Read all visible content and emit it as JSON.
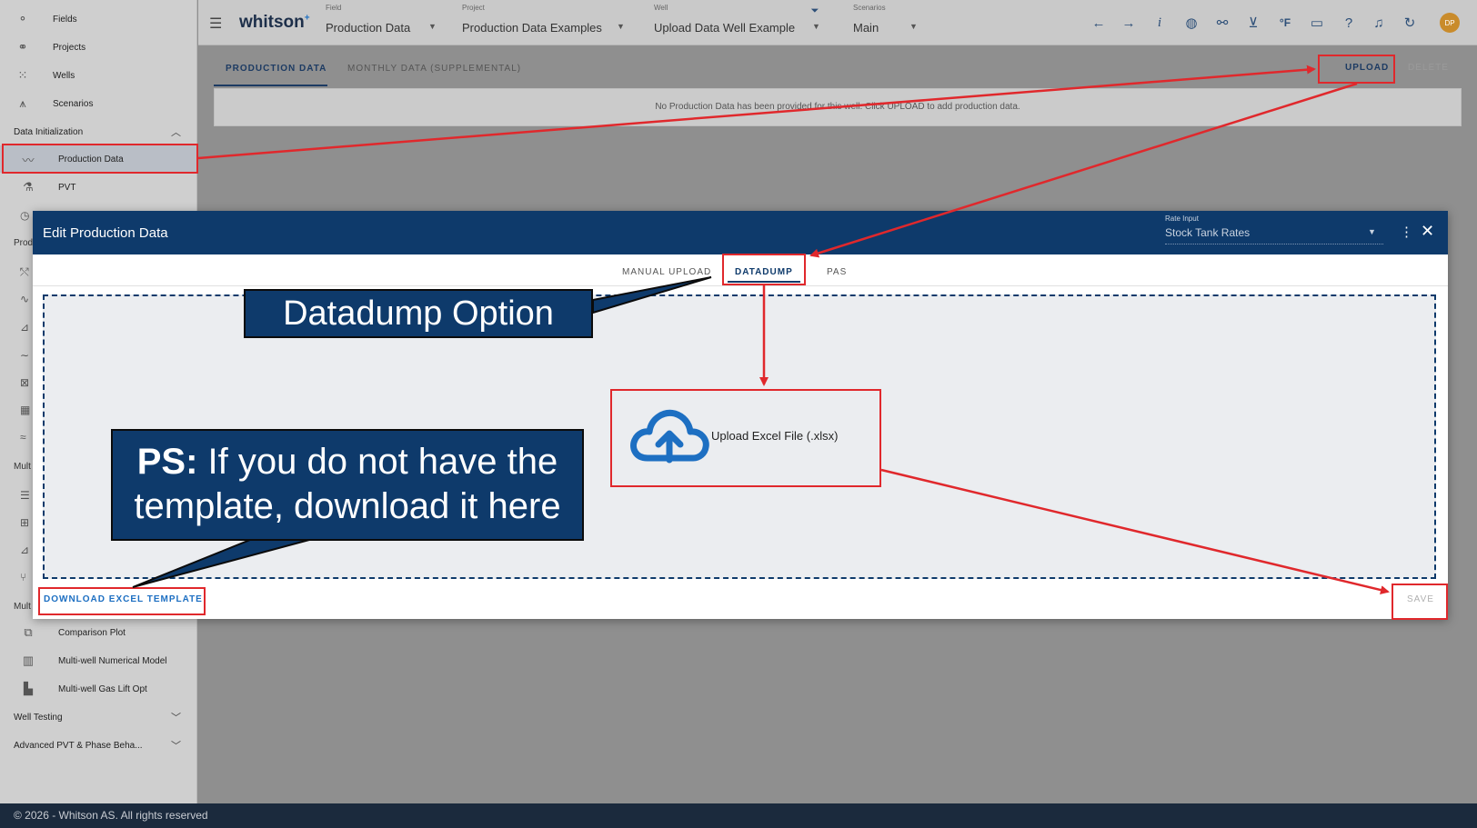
{
  "sidebar": {
    "items": [
      {
        "label": "Fields",
        "icon": "fields-icon"
      },
      {
        "label": "Projects",
        "icon": "projects-icon"
      },
      {
        "label": "Wells",
        "icon": "wells-icon"
      },
      {
        "label": "Scenarios",
        "icon": "scenarios-icon"
      }
    ],
    "section_data_init": "Data Initialization",
    "sub_items": [
      {
        "label": "Production Data",
        "icon": "production-data-icon"
      },
      {
        "label": "PVT",
        "icon": "pvt-icon"
      }
    ],
    "stub_labels": [
      "Prod",
      "Mult",
      "Mult"
    ],
    "bottom_items": [
      {
        "label": "Comparison Plot",
        "icon": "comparison-plot-icon"
      },
      {
        "label": "Multi-well Numerical Model",
        "icon": "numerical-model-icon"
      },
      {
        "label": "Multi-well Gas Lift Opt",
        "icon": "gas-lift-icon"
      }
    ],
    "section_well_testing": "Well Testing",
    "section_advanced_pvt": "Advanced PVT & Phase Beha..."
  },
  "topbar": {
    "brand": "whitson",
    "brand_sup": "+",
    "field": {
      "label": "Field",
      "value": "Production Data"
    },
    "project": {
      "label": "Project",
      "value": "Production Data Examples"
    },
    "well": {
      "label": "Well",
      "value": "Upload Data Well Example"
    },
    "scenarios": {
      "label": "Scenarios",
      "value": "Main"
    },
    "unit_label": "°F",
    "info_label": "i",
    "avatar_initials": "DP"
  },
  "page": {
    "tab_production": "PRODUCTION DATA",
    "tab_monthly": "MONTHLY DATA (SUPPLEMENTAL)",
    "upload_label": "UPLOAD",
    "delete_label": "DELETE",
    "empty_message": "No Production Data has been provided for this well. Click UPLOAD to add production data."
  },
  "modal": {
    "title": "Edit Production Data",
    "rate_input_label": "Rate Input",
    "rate_input_value": "Stock Tank Rates",
    "tab_manual": "MANUAL UPLOAD",
    "tab_datadump": "DATADUMP",
    "tab_pas": "PAS",
    "upload_text": "Upload Excel File (.xlsx)",
    "download_label": "DOWNLOAD EXCEL TEMPLATE",
    "save_label": "SAVE"
  },
  "annotations": {
    "callout_datadump": "Datadump Option",
    "callout_ps_bold": "PS:",
    "callout_ps_line1": " If you do not have the",
    "callout_ps_line2": "template, download it here",
    "highlight_color": "#e0282c",
    "callout_color": "#0e3a6b"
  },
  "footer": {
    "text": "© 2026 - Whitson AS. All rights reserved"
  }
}
